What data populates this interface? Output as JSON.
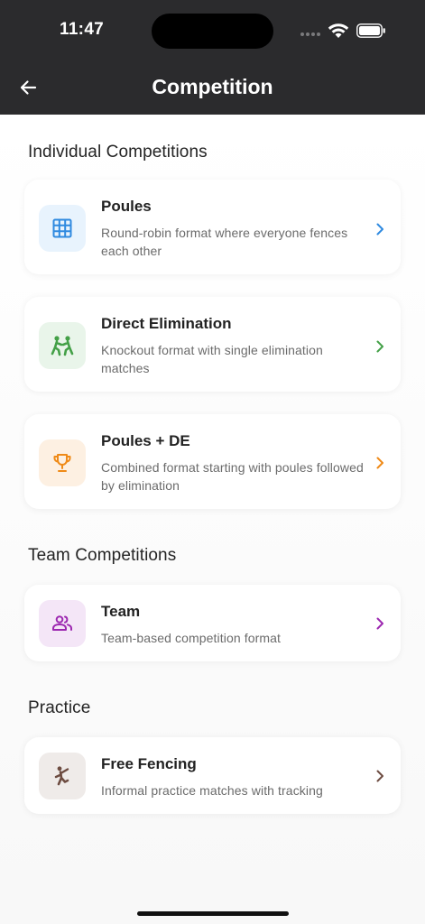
{
  "status_bar": {
    "time": "11:47"
  },
  "header": {
    "title": "Competition"
  },
  "sections": {
    "individual": {
      "title": "Individual Competitions"
    },
    "team": {
      "title": "Team Competitions"
    },
    "practice": {
      "title": "Practice"
    }
  },
  "cards": {
    "poules": {
      "title": "Poules",
      "description": "Round-robin format where everyone fences each other",
      "accent": "#2f8ae0",
      "icon_bg": "#e8f3fd",
      "icon": "grid-icon"
    },
    "direct_elimination": {
      "title": "Direct Elimination",
      "description": "Knockout format with single elimination matches",
      "accent": "#43a047",
      "icon_bg": "#e9f5ea",
      "icon": "fencers-icon"
    },
    "poules_de": {
      "title": "Poules + DE",
      "description": "Combined format starting with poules followed by elimination",
      "accent": "#ef8a17",
      "icon_bg": "#fdf0e2",
      "icon": "trophy-icon"
    },
    "team": {
      "title": "Team",
      "description": "Team-based competition format",
      "accent": "#9c27b0",
      "icon_bg": "#f4e6f7",
      "icon": "group-icon"
    },
    "free_fencing": {
      "title": "Free Fencing",
      "description": "Informal practice matches with tracking",
      "accent": "#6d4c41",
      "icon_bg": "#efebe9",
      "icon": "martial-arts-icon"
    }
  }
}
